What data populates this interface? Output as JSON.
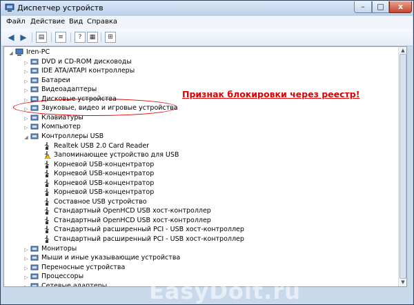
{
  "window": {
    "title": "Диспетчер устройств",
    "min_label": "–",
    "max_label": "□",
    "close_label": "x"
  },
  "menu": [
    "Файл",
    "Действие",
    "Вид",
    "Справка"
  ],
  "tree": {
    "root": "Iren-PC",
    "categories_top": [
      "DVD и CD-ROM дисководы",
      "IDE ATA/ATAPI контроллеры",
      "Батареи",
      "Видеоадаптеры",
      "Дисковые устройства",
      "Звуковые, видео и игровые устройства",
      "Клавиатуры",
      "Компьютер"
    ],
    "usb_category": "Контроллеры USB",
    "usb_children": [
      "Realtek USB 2.0 Card Reader",
      "Запоминающее устройство для USB",
      "Корневой USB-концентратор",
      "Корневой USB-концентратор",
      "Корневой USB-концентратор",
      "Корневой USB-концентратор",
      "Составное USB устройство",
      "Стандартный OpenHCD USB хост-контроллер",
      "Стандартный OpenHCD USB хост-контроллер",
      "Стандартный расширенный PCI - USB хост-контроллер",
      "Стандартный расширенный PCI - USB хост-контроллер"
    ],
    "categories_bottom": [
      "Мониторы",
      "Мыши и иные указывающие устройства",
      "Переносные устройства",
      "Процессоры",
      "Сетевые адаптеры"
    ]
  },
  "annotation": "Признак блокировки через реестр!",
  "watermark": "EasyDoit.ru",
  "colors": {
    "accent_red": "#e00000",
    "window_frame": "#c9d9ec"
  }
}
